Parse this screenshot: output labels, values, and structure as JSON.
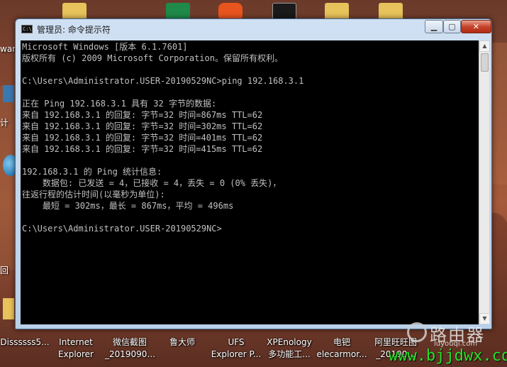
{
  "window": {
    "title": "管理员: 命令提示符",
    "icon_text": "C:\\",
    "minimize_symbol": "▁",
    "maximize_symbol": "▢",
    "close_symbol": "✕"
  },
  "console": {
    "lines": [
      "Microsoft Windows [版本 6.1.7601]",
      "版权所有 (c) 2009 Microsoft Corporation。保留所有权利。",
      "",
      "C:\\Users\\Administrator.USER-20190529NC>ping 192.168.3.1",
      "",
      "正在 Ping 192.168.3.1 具有 32 字节的数据:",
      "来自 192.168.3.1 的回复: 字节=32 时间=867ms TTL=62",
      "来自 192.168.3.1 的回复: 字节=32 时间=302ms TTL=62",
      "来自 192.168.3.1 的回复: 字节=32 时间=401ms TTL=62",
      "来自 192.168.3.1 的回复: 字节=32 时间=415ms TTL=62",
      "",
      "192.168.3.1 的 Ping 统计信息:",
      "    数据包: 已发送 = 4，已接收 = 4，丢失 = 0 (0% 丢失)，",
      "往返行程的估计时间(以毫秒为单位):",
      "    最短 = 302ms，最长 = 867ms，平均 = 496ms",
      "",
      "C:\\Users\\Administrator.USER-20190529NC>"
    ]
  },
  "desktop": {
    "left_fragments": [
      "wan",
      "计",
      "回"
    ],
    "icons": [
      {
        "line1": "Dissssss5...",
        "line2": ""
      },
      {
        "line1": "Internet",
        "line2": "Explorer"
      },
      {
        "line1": "微信截图",
        "line2": "_2019090..."
      },
      {
        "line1": "鲁大师",
        "line2": ""
      },
      {
        "line1": "UFS",
        "line2": "Explorer P..."
      },
      {
        "line1": "XPEnology",
        "line2": "多功能工..."
      },
      {
        "line1": "电钯",
        "line2": "elecarmor..."
      },
      {
        "line1": "阿里旺旺图",
        "line2": "_20190..."
      }
    ]
  },
  "watermark": {
    "brand": "路由器",
    "small": "luyouqi.com",
    "url": "www.bjjdwx.com"
  }
}
